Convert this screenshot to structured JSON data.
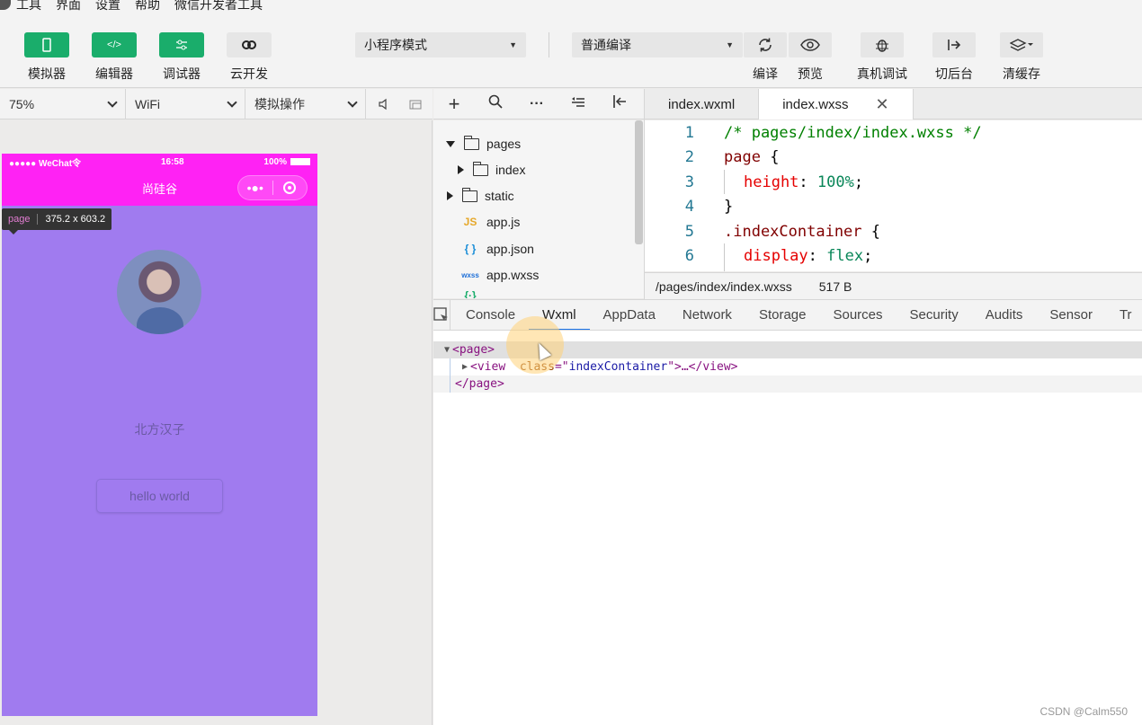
{
  "menu": [
    "工具",
    "界面",
    "设置",
    "帮助",
    "微信开发者工具"
  ],
  "toolbar": {
    "simulator": "模拟器",
    "editor": "编辑器",
    "debugger": "调试器",
    "cloud": "云开发",
    "mode": "小程序模式",
    "compile_mode": "普通编译",
    "compile": "编译",
    "preview": "预览",
    "real_debug": "真机调试",
    "background": "切后台",
    "clear_cache": "清缓存"
  },
  "simbar": {
    "zoom": "75%",
    "network": "WiFi",
    "operation": "模拟操作"
  },
  "phone": {
    "signal": "●●●●● WeChat令",
    "time": "16:58",
    "battery": "100%",
    "title": "尚硅谷",
    "tooltip_tag": "page",
    "tooltip_size": "375.2 x 603.2",
    "nickname": "北方汉子",
    "button": "hello world"
  },
  "tree": {
    "items": [
      {
        "name": "pages"
      },
      {
        "name": "index"
      },
      {
        "name": "static"
      },
      {
        "name": "app.js",
        "icon": "JS"
      },
      {
        "name": "app.json",
        "icon": "{ }"
      },
      {
        "name": "app.wxss",
        "icon": "wxss"
      }
    ]
  },
  "editor": {
    "tabs": [
      "index.wxml",
      "index.wxss"
    ],
    "lines": [
      {
        "n": "1",
        "code": "/* pages/index/index.wxss */"
      },
      {
        "n": "2",
        "sel": "page",
        "pun": " {"
      },
      {
        "n": "3",
        "prop": "height",
        "val": "100%"
      },
      {
        "n": "4",
        "pun": "}"
      },
      {
        "n": "5",
        "sel": ".indexContainer",
        "pun": " {"
      },
      {
        "n": "6",
        "prop": "display",
        "val": "flex"
      }
    ],
    "path": "/pages/index/index.wxss",
    "size": "517 B"
  },
  "devtools": {
    "tabs": [
      "Console",
      "Wxml",
      "AppData",
      "Network",
      "Storage",
      "Sources",
      "Security",
      "Audits",
      "Sensor",
      "Tr"
    ],
    "xml": {
      "open_page": "<page>",
      "view_open": "<view",
      "attr_name": "class",
      "attr_value": "indexContainer",
      "view_close": ">…</view>",
      "close_page": "</page>"
    }
  },
  "watermark": "CSDN @Calm550"
}
